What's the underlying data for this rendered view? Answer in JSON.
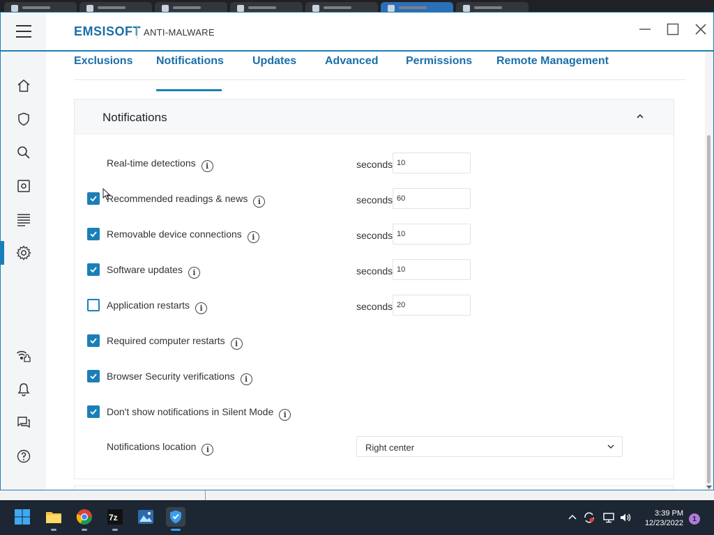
{
  "app": {
    "brand": "EMSISOFT",
    "product": "ANTI-MALWARE"
  },
  "nav": {
    "items": [
      {
        "icon": "home-icon"
      },
      {
        "icon": "shield-icon"
      },
      {
        "icon": "search-icon"
      },
      {
        "icon": "quarantine-icon"
      },
      {
        "icon": "logs-icon"
      },
      {
        "icon": "gear-icon",
        "active": true
      },
      {
        "icon": "connection-icon"
      },
      {
        "icon": "bell-icon"
      },
      {
        "icon": "chat-icon"
      },
      {
        "icon": "help-icon"
      }
    ]
  },
  "tabs": [
    {
      "label": "Exclusions"
    },
    {
      "label": "Notifications",
      "active": true
    },
    {
      "label": "Updates"
    },
    {
      "label": "Advanced"
    },
    {
      "label": "Permissions"
    },
    {
      "label": "Remote Management"
    }
  ],
  "section": {
    "title": "Notifications",
    "rows": [
      {
        "label": "Real-time detections",
        "checkbox": "none",
        "seconds_label": "seconds",
        "seconds": "10"
      },
      {
        "label": "Recommended readings & news",
        "checkbox": "checked",
        "seconds_label": "seconds",
        "seconds": "60"
      },
      {
        "label": "Removable device connections",
        "checkbox": "checked",
        "seconds_label": "seconds",
        "seconds": "10"
      },
      {
        "label": "Software updates",
        "checkbox": "checked",
        "seconds_label": "seconds",
        "seconds": "10"
      },
      {
        "label": "Application restarts",
        "checkbox": "unchecked",
        "seconds_label": "seconds",
        "seconds": "20"
      },
      {
        "label": "Required computer restarts",
        "checkbox": "checked"
      },
      {
        "label": "Browser Security verifications",
        "checkbox": "checked"
      },
      {
        "label": "Don't show notifications in Silent Mode",
        "checkbox": "checked"
      }
    ],
    "location_label": "Notifications location",
    "location_value": "Right center"
  },
  "taskbar": {
    "apps": [
      "start-icon",
      "file-explorer-icon",
      "chrome-icon",
      "7zip-icon",
      "photos-icon",
      "emsisoft-icon"
    ],
    "time": "3:39 PM",
    "date": "12/23/2022",
    "notification_count": "1"
  },
  "colors": {
    "accent": "#1a7fb8",
    "brand": "#1a6fa8",
    "taskbar": "#1d2733"
  }
}
